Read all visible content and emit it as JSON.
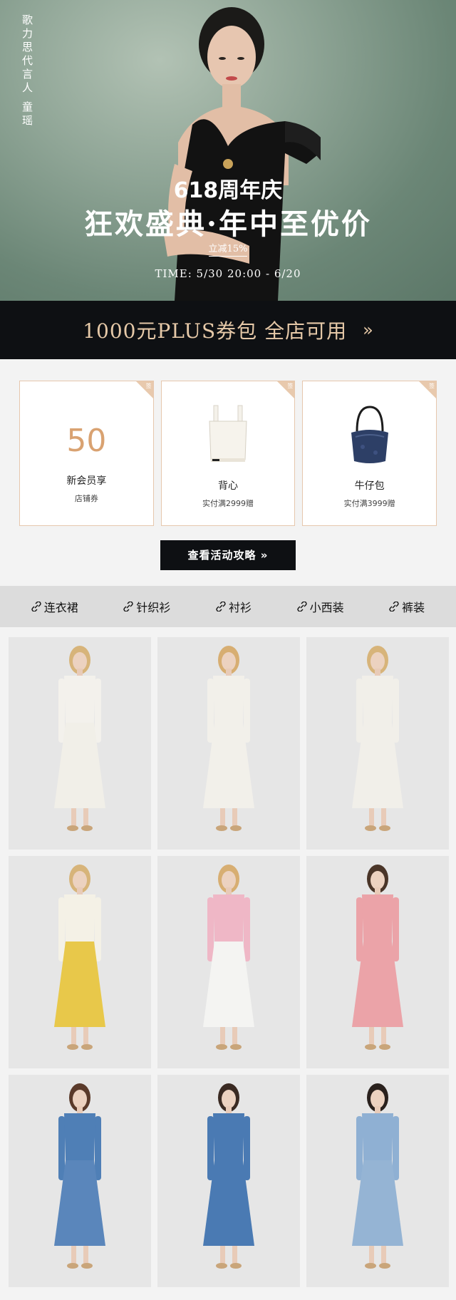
{
  "hero": {
    "spokes": [
      "歌力思代言人",
      "童瑶"
    ],
    "anniv": "618周年庆",
    "main": "狂欢盛典·年中至优价",
    "discount": "立减15%",
    "time": "TIME: 5/30 20:00 - 6/20"
  },
  "plus_bar": {
    "text": "1000元PLUS券包 全店可用",
    "arrow": "»"
  },
  "coupons": [
    {
      "corner": "签",
      "amount": "50",
      "title": "新会员享",
      "subtitle": "店铺券"
    },
    {
      "corner": "签",
      "image": "tank-top",
      "title": "背心",
      "subtitle": "实付满2999赠"
    },
    {
      "corner": "签",
      "image": "denim-bag",
      "title": "牛仔包",
      "subtitle": "实付满3999赠"
    }
  ],
  "guide_button": "查看活动攻略 »",
  "categories": [
    "连衣裙",
    "针织衫",
    "衬衫",
    "小西装",
    "裤装"
  ],
  "products": [
    {
      "name": "white-cami-dress",
      "colors": {
        "top": "#f3f1ec",
        "bottom": "#f1efe8",
        "hair": "#d7b47a"
      }
    },
    {
      "name": "white-belted-dress",
      "colors": {
        "top": "#f2f0ea",
        "bottom": "#f2f0ea",
        "hair": "#d7ae72"
      }
    },
    {
      "name": "white-lace-dress",
      "colors": {
        "top": "#f1efe9",
        "bottom": "#f1efe9",
        "hair": "#d7b47a"
      }
    },
    {
      "name": "yellow-floral-set",
      "colors": {
        "top": "#f4f1e6",
        "bottom": "#e8c84a",
        "hair": "#d7b47a"
      }
    },
    {
      "name": "pink-cardigan-white-pants",
      "colors": {
        "top": "#efb7c6",
        "bottom": "#f4f4f2",
        "hair": "#d7ae72"
      }
    },
    {
      "name": "pink-knit-dress",
      "colors": {
        "top": "#eba3a8",
        "bottom": "#eba3a8",
        "hair": "#4a3528"
      }
    },
    {
      "name": "denim-shirt-dress",
      "colors": {
        "top": "#4f7fb6",
        "bottom": "#5a86bb",
        "hair": "#5a3a2a"
      }
    },
    {
      "name": "denim-tiered-dress",
      "colors": {
        "top": "#4a7ab3",
        "bottom": "#4a7ab3",
        "hair": "#3a2a22"
      }
    },
    {
      "name": "light-denim-dress",
      "colors": {
        "top": "#8fb0d3",
        "bottom": "#95b4d4",
        "hair": "#2a211d"
      }
    }
  ]
}
